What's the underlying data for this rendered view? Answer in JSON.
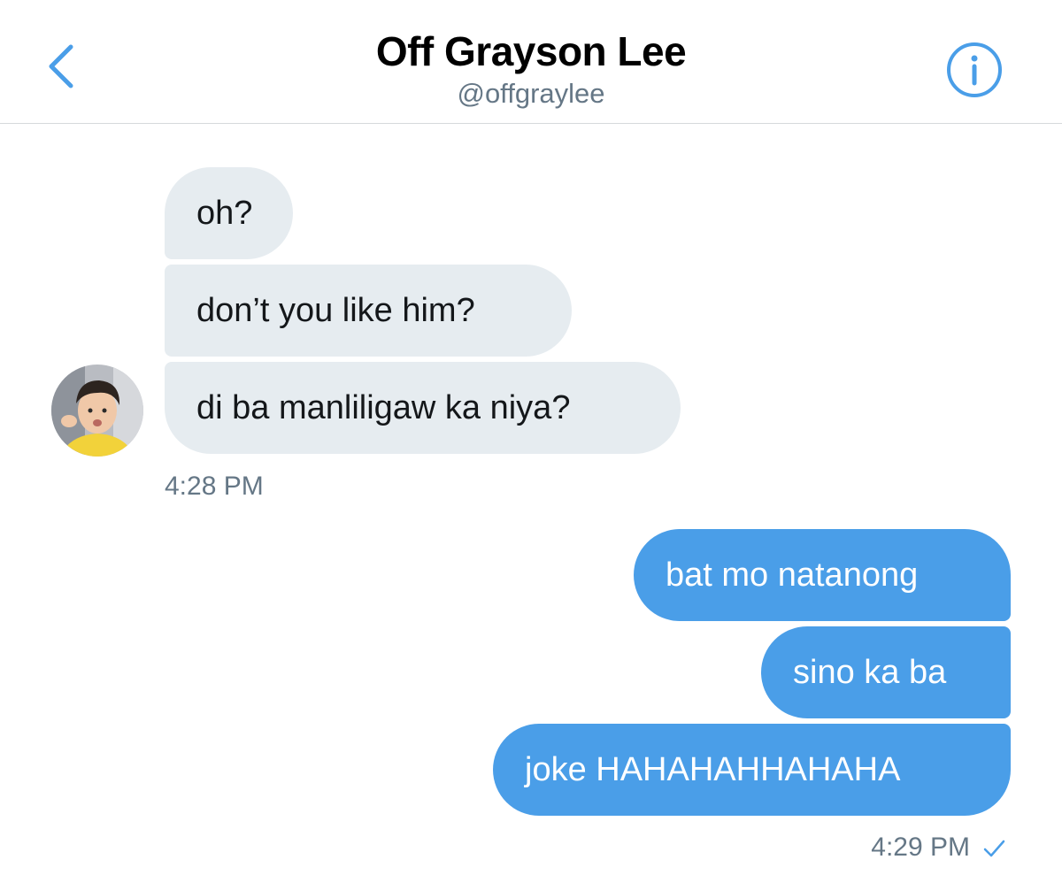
{
  "header": {
    "title": "Off Grayson Lee",
    "handle": "@offgraylee",
    "back_icon": "chevron-left-icon",
    "info_icon": "info-icon"
  },
  "colors": {
    "accent": "#4a9ee8",
    "incoming_bubble": "#e6ecf0",
    "muted_text": "#657786"
  },
  "conversation": {
    "incoming": {
      "messages": [
        "oh?",
        "don’t you like him?",
        "di ba manliligaw ka niya?"
      ],
      "timestamp": "4:28 PM"
    },
    "outgoing": {
      "messages": [
        "bat mo natanong",
        "sino ka ba",
        "joke HAHAHAHHAHAHA"
      ],
      "timestamp": "4:29 PM",
      "status_icon": "checkmark-icon"
    }
  }
}
